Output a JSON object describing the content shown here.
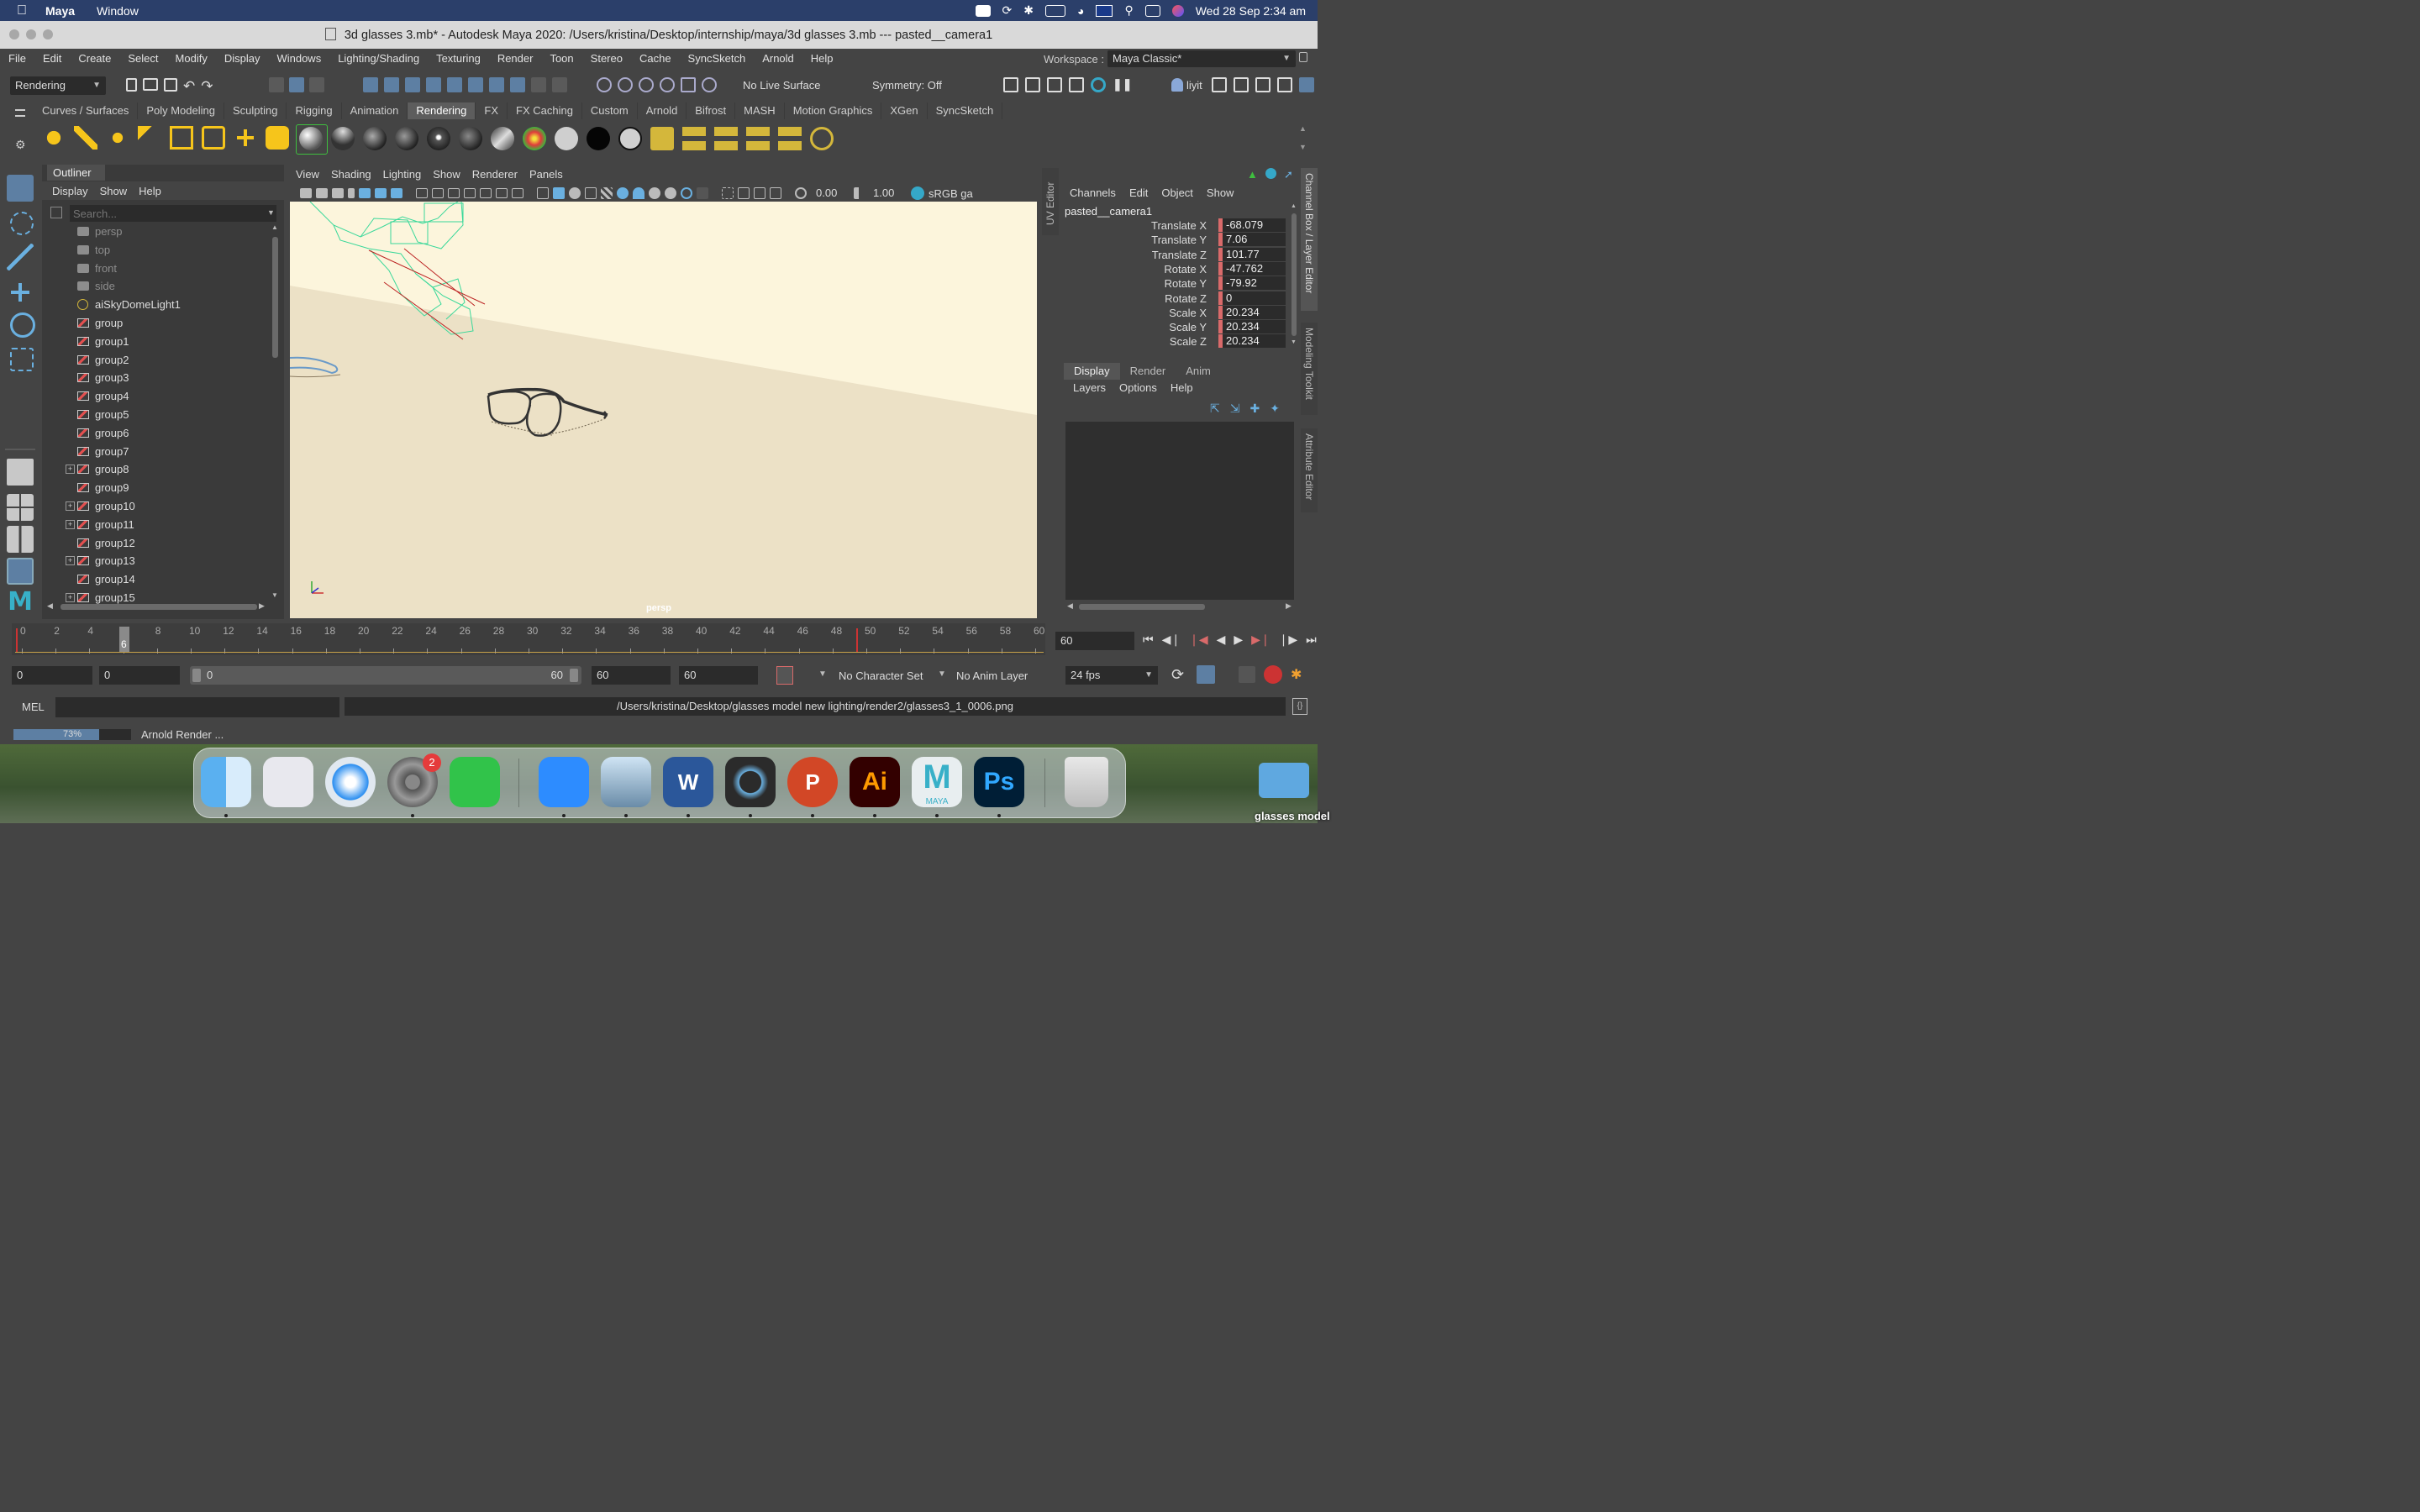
{
  "colors": {
    "menubar": "#2b3f6a",
    "panel": "#444444",
    "field": "#2b2b2b",
    "viewport_bg": "#f1e8d0",
    "highlight": "#5d7fa3",
    "keyed_red": "#d96a6a"
  },
  "mac_menubar": {
    "app": "Maya",
    "items": [
      "Window"
    ],
    "clock": "Wed 28 Sep  2:34 am"
  },
  "window": {
    "title": "3d glasses 3.mb* - Autodesk Maya 2020: /Users/kristina/Desktop/internship/maya/3d glasses 3.mb   ---   pasted__camera1"
  },
  "menus": [
    "File",
    "Edit",
    "Create",
    "Select",
    "Modify",
    "Display",
    "Windows",
    "Lighting/Shading",
    "Texturing",
    "Render",
    "Toon",
    "Stereo",
    "Cache",
    "SyncSketch",
    "Arnold",
    "Help"
  ],
  "workspace": {
    "label": "Workspace :",
    "value": "Maya Classic*"
  },
  "statusline": {
    "mode": "Rendering",
    "live_surface": "No Live Surface",
    "symmetry": "Symmetry: Off",
    "user": "liyit"
  },
  "shelf_tabs": [
    "Curves / Surfaces",
    "Poly Modeling",
    "Sculpting",
    "Rigging",
    "Animation",
    "Rendering",
    "FX",
    "FX Caching",
    "Custom",
    "Arnold",
    "Bifrost",
    "MASH",
    "Motion Graphics",
    "XGen",
    "SyncSketch"
  ],
  "shelf_active": "Rendering",
  "outliner": {
    "title": "Outliner",
    "menus": [
      "Display",
      "Show",
      "Help"
    ],
    "search_placeholder": "Search...",
    "items": [
      {
        "name": "persp",
        "type": "camera",
        "dim": true
      },
      {
        "name": "top",
        "type": "camera",
        "dim": true
      },
      {
        "name": "front",
        "type": "camera",
        "dim": true
      },
      {
        "name": "side",
        "type": "camera",
        "dim": true
      },
      {
        "name": "aiSkyDomeLight1",
        "type": "light"
      },
      {
        "name": "group",
        "type": "group"
      },
      {
        "name": "group1",
        "type": "group"
      },
      {
        "name": "group2",
        "type": "group"
      },
      {
        "name": "group3",
        "type": "group"
      },
      {
        "name": "group4",
        "type": "group"
      },
      {
        "name": "group5",
        "type": "group"
      },
      {
        "name": "group6",
        "type": "group"
      },
      {
        "name": "group7",
        "type": "group"
      },
      {
        "name": "group8",
        "type": "group",
        "expandable": true
      },
      {
        "name": "group9",
        "type": "group"
      },
      {
        "name": "group10",
        "type": "group",
        "expandable": true
      },
      {
        "name": "group11",
        "type": "group",
        "expandable": true
      },
      {
        "name": "group12",
        "type": "group"
      },
      {
        "name": "group13",
        "type": "group",
        "expandable": true
      },
      {
        "name": "group14",
        "type": "group"
      },
      {
        "name": "group15",
        "type": "group",
        "expandable": true
      }
    ]
  },
  "viewport": {
    "menus": [
      "View",
      "Shading",
      "Lighting",
      "Show",
      "Renderer",
      "Panels"
    ],
    "exposure": "0.00",
    "gamma": "1.00",
    "color_space": "sRGB ga",
    "camera_label": "persp"
  },
  "side_tabs": {
    "uv_editor": "UV Editor",
    "channel_box": "Channel Box / Layer Editor",
    "modeling_toolkit": "Modeling Toolkit",
    "attribute_editor": "Attribute Editor"
  },
  "channel_box": {
    "menus": [
      "Channels",
      "Edit",
      "Object",
      "Show"
    ],
    "object": "pasted__camera1",
    "channels": [
      {
        "name": "Translate X",
        "value": "-68.079"
      },
      {
        "name": "Translate Y",
        "value": "7.06"
      },
      {
        "name": "Translate Z",
        "value": "101.77"
      },
      {
        "name": "Rotate X",
        "value": "-47.762"
      },
      {
        "name": "Rotate Y",
        "value": "-79.92"
      },
      {
        "name": "Rotate Z",
        "value": "0"
      },
      {
        "name": "Scale X",
        "value": "20.234"
      },
      {
        "name": "Scale Y",
        "value": "20.234"
      },
      {
        "name": "Scale Z",
        "value": "20.234"
      }
    ]
  },
  "layer_editor": {
    "tabs": [
      "Display",
      "Render",
      "Anim"
    ],
    "menus": [
      "Layers",
      "Options",
      "Help"
    ]
  },
  "timeline": {
    "ticks": [
      "0",
      "2",
      "4",
      "6",
      "8",
      "10",
      "12",
      "14",
      "16",
      "18",
      "20",
      "22",
      "24",
      "26",
      "28",
      "30",
      "32",
      "34",
      "36",
      "38",
      "40",
      "42",
      "44",
      "46",
      "48",
      "50",
      "52",
      "54",
      "56",
      "58",
      "60"
    ],
    "current_frame": "6",
    "frame_field": "60"
  },
  "range": {
    "start": "0",
    "anim_start": "0",
    "slider_start": "0",
    "slider_end": "60",
    "end": "60",
    "anim_end": "60",
    "character_set": "No Character Set",
    "anim_layer": "No Anim Layer",
    "fps": "24 fps"
  },
  "command": {
    "lang": "MEL",
    "output": "/Users/kristina/Desktop/glasses model new lighting/render2/glasses3_1_0006.png"
  },
  "help": {
    "progress_percent": 73,
    "progress_label": "73%",
    "status": "Arnold Render ..."
  },
  "dock": {
    "apps": [
      "Finder",
      "Launchpad",
      "Safari",
      "System Preferences",
      "WeChat",
      "Zoom",
      "Preview",
      "Word",
      "QuickTime",
      "PowerPoint",
      "Illustrator",
      "Maya",
      "Photoshop",
      "Trash"
    ],
    "badge": "2",
    "ai_label": "Ai",
    "ps_label": "Ps",
    "maya_label": "MAYA",
    "word_label": "W",
    "ppt_label": "P"
  },
  "desktop_file": "glasses model"
}
